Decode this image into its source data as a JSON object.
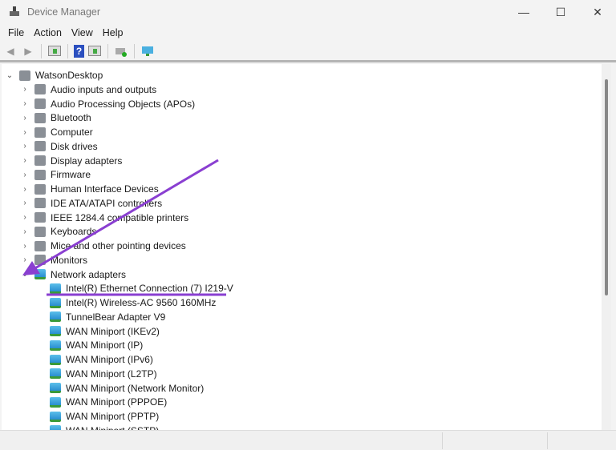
{
  "window": {
    "title": "Device Manager",
    "minimize": "—",
    "maximize": "☐",
    "close": "✕"
  },
  "menu": [
    "File",
    "Action",
    "View",
    "Help"
  ],
  "toolbar": {
    "back": "back-icon",
    "forward": "forward-icon",
    "properties": "properties-icon",
    "help": "?",
    "update": "update-driver-icon",
    "scan": "scan-hardware-icon",
    "monitor": "monitor-icon"
  },
  "tree": {
    "root": "WatsonDesktop",
    "categories": [
      "Audio inputs and outputs",
      "Audio Processing Objects (APOs)",
      "Bluetooth",
      "Computer",
      "Disk drives",
      "Display adapters",
      "Firmware",
      "Human Interface Devices",
      "IDE ATA/ATAPI controllers",
      "IEEE 1284.4 compatible printers",
      "Keyboards",
      "Mice and other pointing devices",
      "Monitors",
      "Network adapters"
    ],
    "network_adapters": [
      "Intel(R) Ethernet Connection (7) I219-V",
      "Intel(R) Wireless-AC 9560 160MHz",
      "TunnelBear Adapter V9",
      "WAN Miniport (IKEv2)",
      "WAN Miniport (IP)",
      "WAN Miniport (IPv6)",
      "WAN Miniport (L2TP)",
      "WAN Miniport (Network Monitor)",
      "WAN Miniport (PPPOE)",
      "WAN Miniport (PPTP)",
      "WAN Miniport (SSTP)"
    ]
  },
  "colors": {
    "annotation": "#8a3fd1"
  }
}
